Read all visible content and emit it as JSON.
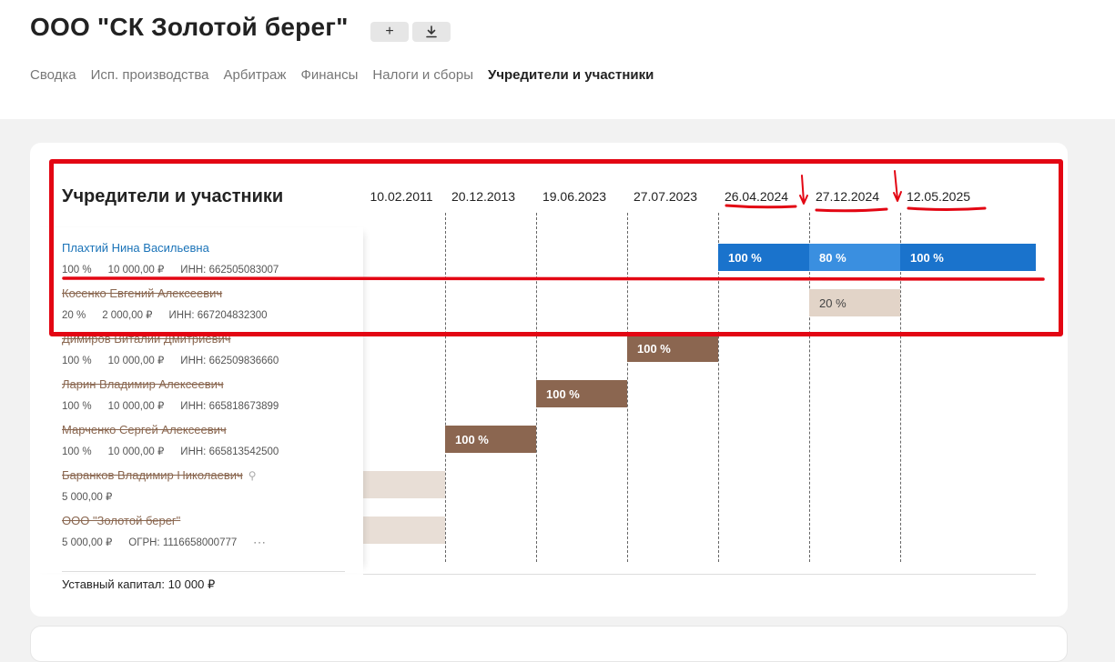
{
  "header": {
    "company_title": "ООО \"СК Золотой берег\"",
    "add_icon": "plus-icon",
    "download_icon": "download-icon"
  },
  "nav": {
    "tabs": [
      {
        "label": "Сводка",
        "active": false
      },
      {
        "label": "Исп. производства",
        "active": false
      },
      {
        "label": "Арбитраж",
        "active": false
      },
      {
        "label": "Финансы",
        "active": false
      },
      {
        "label": "Налоги и сборы",
        "active": false
      },
      {
        "label": "Учредители и участники",
        "active": true
      }
    ]
  },
  "section": {
    "title": "Учредители и участники",
    "capital_label": "Уставный капитал: 10 000 ₽",
    "more_label": "···"
  },
  "timeline": {
    "dates": [
      "10.02.2011",
      "20.12.2013",
      "19.06.2023",
      "27.07.2023",
      "26.04.2024",
      "27.12.2024",
      "12.05.2025"
    ]
  },
  "people": [
    {
      "name": "Плахтий Нина Васильевна",
      "active": true,
      "share": "100 %",
      "amount": "10 000,00 ₽",
      "id": "ИНН: 662505083007"
    },
    {
      "name": "Косенко Евгений Алексеевич",
      "active": false,
      "share": "20 %",
      "amount": "2 000,00 ₽",
      "id": "ИНН: 667204832300"
    },
    {
      "name": "Димиров Виталий Дмитриевич",
      "active": false,
      "share": "100 %",
      "amount": "10 000,00 ₽",
      "id": "ИНН: 662509836660"
    },
    {
      "name": "Ларин Владимир Алексеевич",
      "active": false,
      "share": "100 %",
      "amount": "10 000,00 ₽",
      "id": "ИНН: 665818673899"
    },
    {
      "name": "Марченко Сергей Алексеевич",
      "active": false,
      "share": "100 %",
      "amount": "10 000,00 ₽",
      "id": "ИНН: 665813542500"
    },
    {
      "name": "Баранков Владимир Николаевич",
      "active": false,
      "share": "",
      "amount": "5 000,00 ₽",
      "id": ""
    },
    {
      "name": "ООО \"Золотой берег\"",
      "active": false,
      "share": "",
      "amount": "5 000,00 ₽",
      "id": "ОГРН: 1116658000777"
    }
  ],
  "bars": [
    {
      "person": 0,
      "from": 4,
      "to": 5,
      "label": "100 %",
      "color": "#1a73cc"
    },
    {
      "person": 0,
      "from": 5,
      "to": 6,
      "label": "80 %",
      "color": "#3a8fe0"
    },
    {
      "person": 0,
      "from": 6,
      "to": 7,
      "label": "100 %",
      "color": "#1a73cc"
    },
    {
      "person": 1,
      "from": 5,
      "to": 6,
      "label": "20 %",
      "color": "#e2d4c8"
    },
    {
      "person": 2,
      "from": 3,
      "to": 4,
      "label": "100 %",
      "color": "#8b6650"
    },
    {
      "person": 3,
      "from": 2,
      "to": 3,
      "label": "100 %",
      "color": "#8b6650"
    },
    {
      "person": 4,
      "from": 1,
      "to": 2,
      "label": "100 %",
      "color": "#8b6650"
    },
    {
      "person": 5,
      "from": 0,
      "to": 1,
      "label": "",
      "color": "#e8ded6"
    },
    {
      "person": 6,
      "from": 0,
      "to": 1,
      "label": "",
      "color": "#e8ded6"
    }
  ],
  "annotation_color": "#e30613"
}
